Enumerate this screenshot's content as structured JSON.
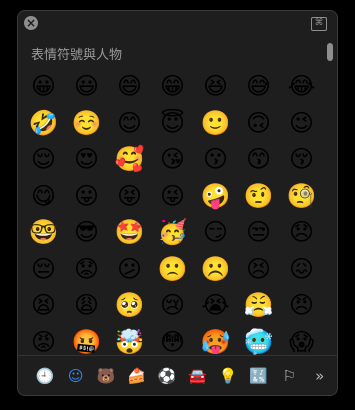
{
  "section_title": "表情符號與人物",
  "emojis": [
    "😀",
    "😃",
    "😄",
    "😁",
    "😆",
    "😅",
    "😂",
    "🤣",
    "☺️",
    "😊",
    "😇",
    "🙂",
    "🙃",
    "😉",
    "😌",
    "😍",
    "🥰",
    "😘",
    "😗",
    "😙",
    "😚",
    "😋",
    "😛",
    "😝",
    "😜",
    "🤪",
    "🤨",
    "🧐",
    "🤓",
    "😎",
    "🤩",
    "🥳",
    "😏",
    "😒",
    "😞",
    "😔",
    "😟",
    "😕",
    "🙁",
    "☹️",
    "😣",
    "😖",
    "😫",
    "😩",
    "🥺",
    "😢",
    "😭",
    "😤",
    "😠",
    "😡",
    "🤬",
    "🤯",
    "😳",
    "🥵",
    "🥶",
    "😱"
  ],
  "categories": [
    {
      "name": "frequently-used",
      "glyph": "🕘"
    },
    {
      "name": "smileys-people",
      "glyph": "☺"
    },
    {
      "name": "animals-nature",
      "glyph": "🐻"
    },
    {
      "name": "food-drink",
      "glyph": "🍰"
    },
    {
      "name": "activity",
      "glyph": "⚽"
    },
    {
      "name": "travel-places",
      "glyph": "🚘"
    },
    {
      "name": "objects",
      "glyph": "💡"
    },
    {
      "name": "symbols",
      "glyph": "🔣"
    },
    {
      "name": "flags",
      "glyph": "⚐"
    },
    {
      "name": "more",
      "glyph": "»"
    }
  ],
  "active_category": "smileys-people",
  "accent_color": "#2f8cff"
}
